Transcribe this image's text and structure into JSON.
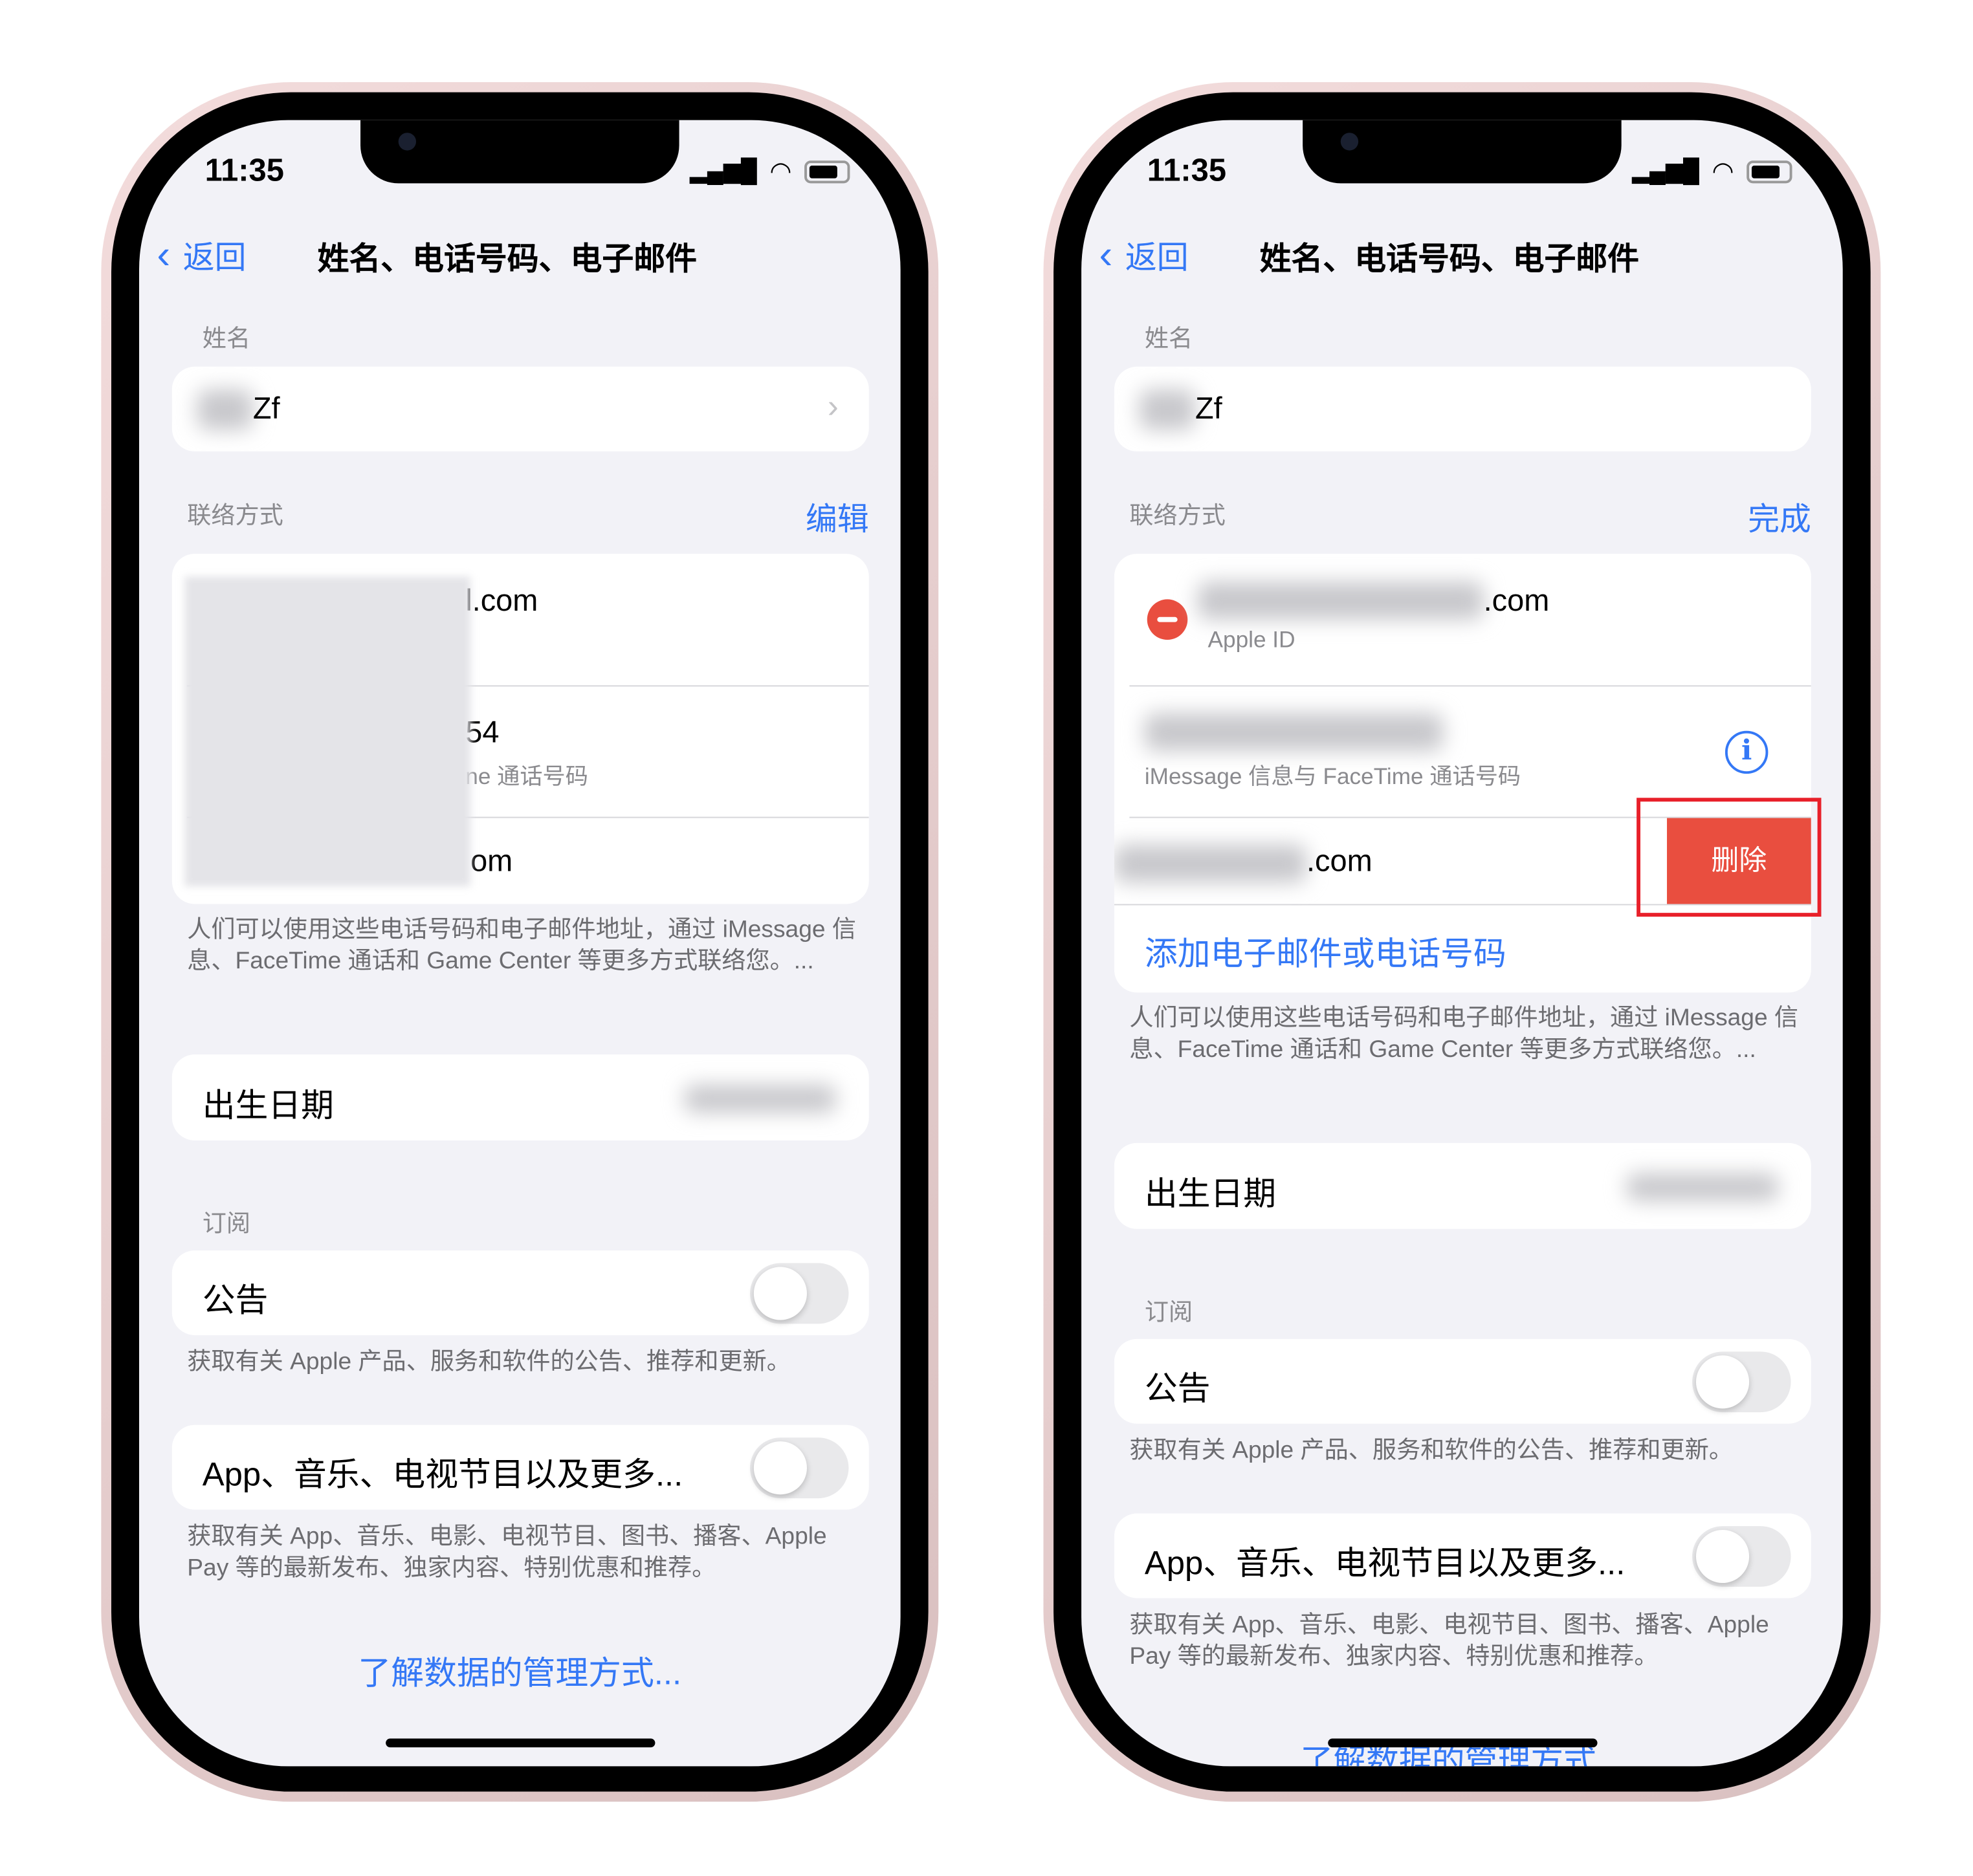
{
  "status": {
    "time": "11:35"
  },
  "nav": {
    "back": "返回",
    "title": "姓名、电话号码、电子邮件"
  },
  "name_section": {
    "label": "姓名",
    "value": "Zf"
  },
  "contact_section": {
    "label": "联络方式",
    "edit": "编辑",
    "done": "完成"
  },
  "left_contacts": [
    {
      "value": "l.com"
    },
    {
      "value": "54",
      "sub": "ne 通话号码"
    },
    {
      "value": "om"
    }
  ],
  "right_contacts": [
    {
      "value": ".com",
      "sub": "Apple ID"
    },
    {
      "sub": "iMessage 信息与 FaceTime 通话号码"
    },
    {
      "value": ".com"
    }
  ],
  "delete_label": "删除",
  "add_label": "添加电子邮件或电话号码",
  "contact_note": "人们可以使用这些电话号码和电子邮件地址，通过 iMessage 信息、FaceTime 通话和 Game Center 等更多方式联络您。...",
  "birthday": {
    "label": "出生日期"
  },
  "subscriptions": {
    "label": "订阅",
    "items": [
      {
        "label": "公告",
        "note": "获取有关 Apple 产品、服务和软件的公告、推荐和更新。",
        "on": false
      },
      {
        "label": "App、音乐、电视节目以及更多...",
        "note": "获取有关 App、音乐、电影、电视节目、图书、播客、Apple Pay 等的最新发布、独家内容、特别优惠和推荐。",
        "on": false
      }
    ]
  },
  "learn_more": "了解数据的管理方式...",
  "colors": {
    "accent": "#3478f6",
    "delete": "#e94e3f",
    "highlight": "#e8202a"
  }
}
